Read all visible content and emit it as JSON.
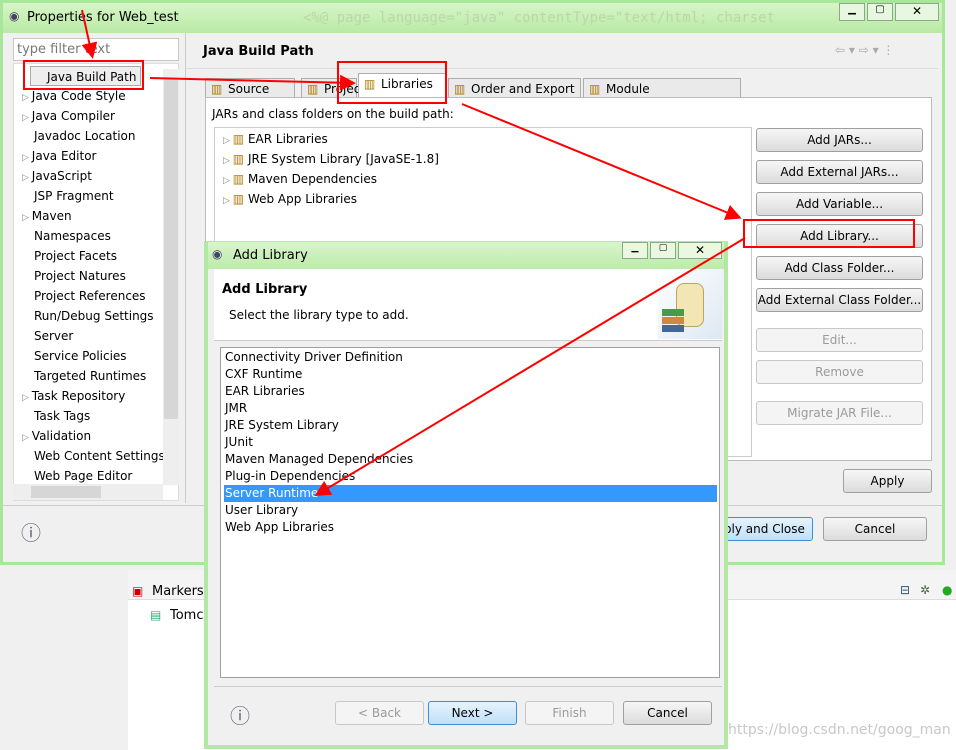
{
  "main_window": {
    "title": "Properties for Web_test",
    "filter_placeholder": "type filter text",
    "nav": [
      "Java Build Path",
      "Java Code Style",
      "Java Compiler",
      "Javadoc Location",
      "Java Editor",
      "JavaScript",
      "JSP Fragment",
      "Maven",
      "Namespaces",
      "Project Facets",
      "Project Natures",
      "Project References",
      "Run/Debug Settings",
      "Server",
      "Service Policies",
      "Targeted Runtimes",
      "Task Repository",
      "Task Tags",
      "Validation",
      "Web Content Settings",
      "Web Page Editor"
    ],
    "nav_expandable": [
      false,
      true,
      true,
      false,
      true,
      true,
      false,
      true,
      false,
      false,
      false,
      false,
      false,
      false,
      false,
      false,
      true,
      false,
      true,
      false,
      false
    ],
    "page_title": "Java Build Path",
    "tabs": [
      "Source",
      "Projects",
      "Libraries",
      "Order and Export",
      "Module Dependencies"
    ],
    "active_tab": "Libraries",
    "libraries_label": "JARs and class folders on the build path:",
    "libraries": [
      "EAR Libraries",
      "JRE System Library [JavaSE-1.8]",
      "Maven Dependencies",
      "Web App Libraries"
    ],
    "buttons": {
      "add_jars": "Add JARs...",
      "add_external_jars": "Add External JARs...",
      "add_variable": "Add Variable...",
      "add_library": "Add Library...",
      "add_class_folder": "Add Class Folder...",
      "add_external_class_folder": "Add External Class Folder...",
      "edit": "Edit...",
      "remove": "Remove",
      "migrate": "Migrate JAR File...",
      "apply": "Apply",
      "apply_close": "Apply and Close",
      "cancel": "Cancel"
    }
  },
  "background": {
    "code_text": "<%@ page language=\"java\" contentType=\"text/html; charset",
    "markers_tab": "Markers",
    "tomcat_item": "Tomca"
  },
  "dialog": {
    "title": "Add Library",
    "heading": "Add Library",
    "subtitle": "Select the library type to add.",
    "items": [
      "Connectivity Driver Definition",
      "CXF Runtime",
      "EAR Libraries",
      "JMR",
      "JRE System Library",
      "JUnit",
      "Maven Managed Dependencies",
      "Plug-in Dependencies",
      "Server Runtime",
      "User Library",
      "Web App Libraries"
    ],
    "selected": "Server Runtime",
    "buttons": {
      "back": "< Back",
      "next": "Next >",
      "finish": "Finish",
      "cancel": "Cancel"
    }
  },
  "watermark": "https://blog.csdn.net/goog_man",
  "colors": {
    "selection": "#3399ff",
    "annotation": "#ff0000",
    "window_border": "#a8e69a"
  }
}
